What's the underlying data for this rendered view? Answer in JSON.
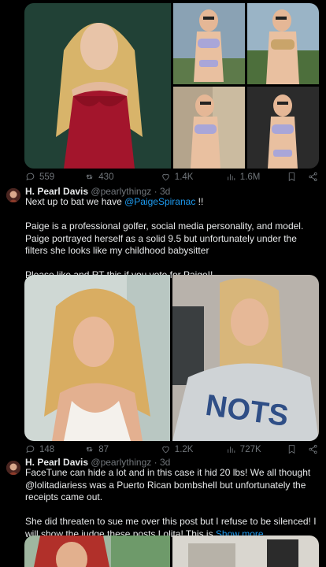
{
  "tweet1": {
    "stats": {
      "replies": "559",
      "retweets": "430",
      "likes": "1.4K",
      "views": "1.6M"
    }
  },
  "tweet2": {
    "author_name": "H. Pearl Davis",
    "handle": "@pearlythingz",
    "dot": "·",
    "time": "3d",
    "line1_prefix": "Next up to bat we have ",
    "line1_mention": "@PaigeSpiranac",
    "line1_suffix": " !!",
    "para2": "Paige is a professional golfer, social media personality, and model. Paige portrayed herself as a solid 9.5 but unfortunately under the filters she looks like my childhood babysitter",
    "para3": "Please like and RT this if you vote for Paige!!",
    "stats": {
      "replies": "148",
      "retweets": "87",
      "likes": "1.2K",
      "views": "727K"
    }
  },
  "tweet3": {
    "author_name": "H. Pearl Davis",
    "handle": "@pearlythingz",
    "dot": "·",
    "time": "3d",
    "para1": "FaceTune can hide a lot and in this case it hid 20 lbs! We all thought @lolitadiariess was a Puerto Rican bombshell but unfortunately the receipts came out.",
    "para2": "She did  threaten to sue me over this post but I refuse to be silenced! I will show the judge these posts Lolita! This is ",
    "show_more": "Show more"
  },
  "icons": [
    "reply-icon",
    "retweet-icon",
    "like-icon",
    "views-icon",
    "bookmark-icon",
    "share-icon"
  ],
  "colors": {
    "background": "#000000",
    "text": "#e7e9ea",
    "secondary": "#71767b",
    "link": "#1d9bf0"
  }
}
